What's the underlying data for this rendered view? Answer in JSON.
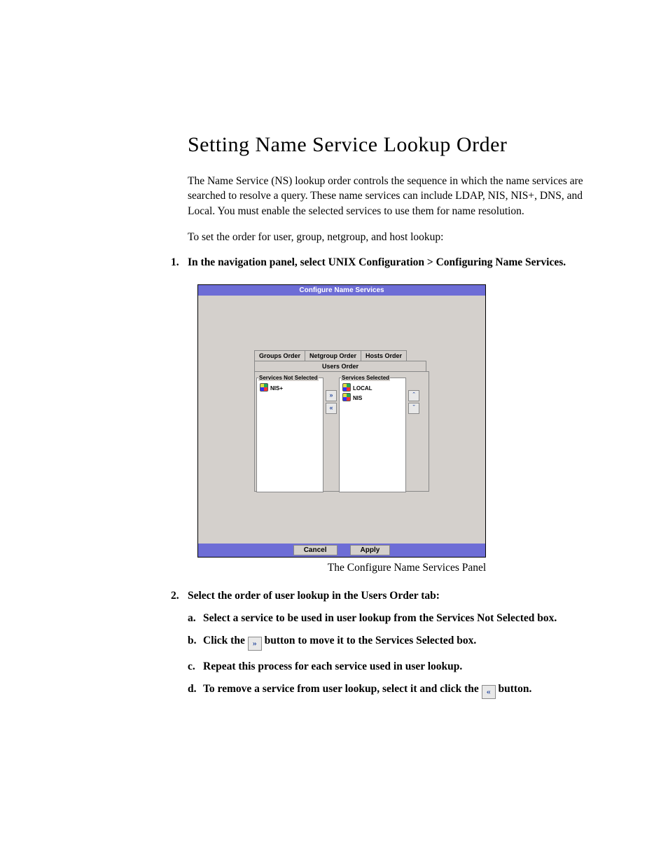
{
  "heading": "Setting Name Service Lookup Order",
  "intro1": "The Name Service (NS) lookup order controls the sequence in which the name services are searched to resolve a query. These name services can include LDAP, NIS, NIS+, DNS, and Local. You must enable the selected services to use them for name resolution.",
  "intro2": "To set the order for user, group, netgroup, and host lookup:",
  "step1": "In the navigation panel, select UNIX Configuration > Configuring Name Services.",
  "panel": {
    "title": "Configure Name Services",
    "tabs_top": [
      "Groups Order",
      "Netgroup Order",
      "Hosts Order"
    ],
    "tab_active": "Users Order",
    "left_legend": "Services Not Selected",
    "right_legend": "Services Selected",
    "not_selected": [
      "NIS+"
    ],
    "selected": [
      "LOCAL",
      "NIS"
    ],
    "btn_cancel": "Cancel",
    "btn_apply": "Apply"
  },
  "caption": "The Configure Name Services Panel",
  "step2": "Select the order of user lookup in the Users Order tab:",
  "step2a": "Select a service to be used in user lookup from the Services Not Selected box.",
  "step2b_pre": "Click the ",
  "step2b_post": " button to move it to the Services Selected box.",
  "step2c": "Repeat this process for each service used in user lookup.",
  "step2d_pre": "To remove a service from user lookup, select it and click the ",
  "step2d_post": " button."
}
